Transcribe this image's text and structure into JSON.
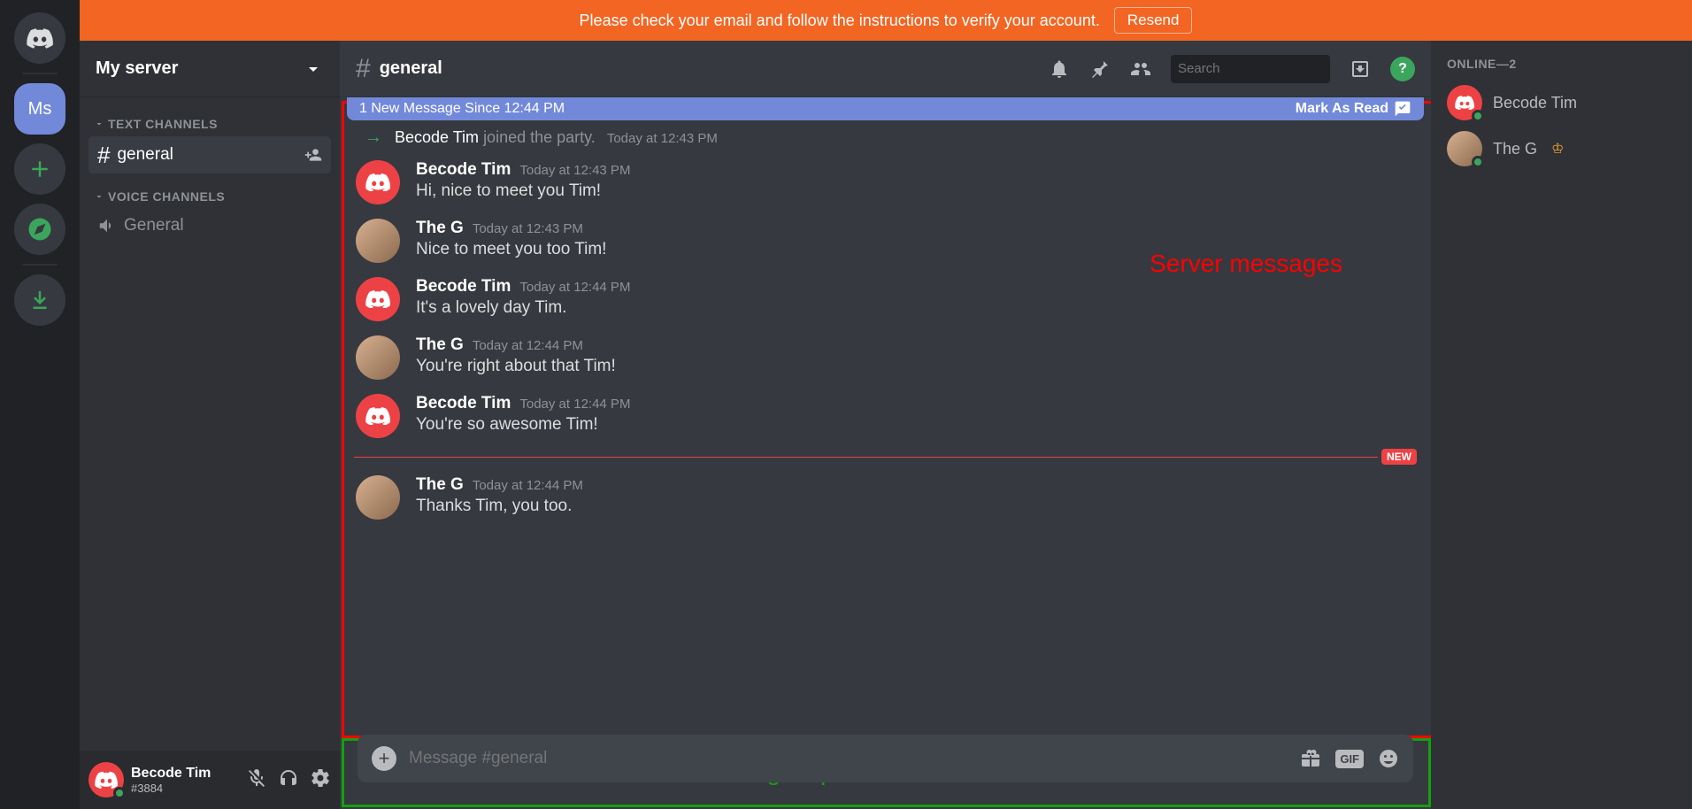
{
  "banner": {
    "text": "Please check your email and follow the instructions to verify your account.",
    "resend": "Resend"
  },
  "server_nav": {
    "active_initials": "Ms"
  },
  "sidebar": {
    "server_name": "My server",
    "text_channels_header": "TEXT CHANNELS",
    "voice_channels_header": "VOICE CHANNELS",
    "text_channel": "general",
    "voice_channel": "General"
  },
  "user_panel": {
    "name": "Becode Tim",
    "tag": "#3884"
  },
  "header": {
    "channel": "general",
    "search_placeholder": "Search"
  },
  "new_message_bar": {
    "text": "1 New Message Since 12:44 PM",
    "mark_read": "Mark As Read"
  },
  "system_message": {
    "user": "Becode Tim",
    "text": "joined the party.",
    "timestamp": "Today at 12:43 PM"
  },
  "messages": [
    {
      "author": "Becode Tim",
      "avatar": "red",
      "timestamp": "Today at 12:43 PM",
      "text": "Hi, nice to meet you Tim!"
    },
    {
      "author": "The G",
      "avatar": "pic",
      "timestamp": "Today at 12:43 PM",
      "text": "Nice to meet you too Tim!"
    },
    {
      "author": "Becode Tim",
      "avatar": "red",
      "timestamp": "Today at 12:44 PM",
      "text": "It's a lovely day Tim."
    },
    {
      "author": "The G",
      "avatar": "pic",
      "timestamp": "Today at 12:44 PM",
      "text": "You're right about that Tim!"
    },
    {
      "author": "Becode Tim",
      "avatar": "red",
      "timestamp": "Today at 12:44 PM",
      "text": "You're so awesome Tim!"
    }
  ],
  "divider_label": "NEW",
  "messages_after_divider": [
    {
      "author": "The G",
      "avatar": "pic",
      "timestamp": "Today at 12:44 PM",
      "text": "Thanks Tim, you too."
    }
  ],
  "input": {
    "placeholder": "Message #general"
  },
  "members": {
    "header": "ONLINE—2",
    "list": [
      {
        "name": "Becode Tim",
        "avatar": "red",
        "crown": false
      },
      {
        "name": "The G",
        "avatar": "pic",
        "crown": true
      }
    ]
  },
  "annotations": {
    "messages_label": "Server messages",
    "input_label": "Message input"
  }
}
